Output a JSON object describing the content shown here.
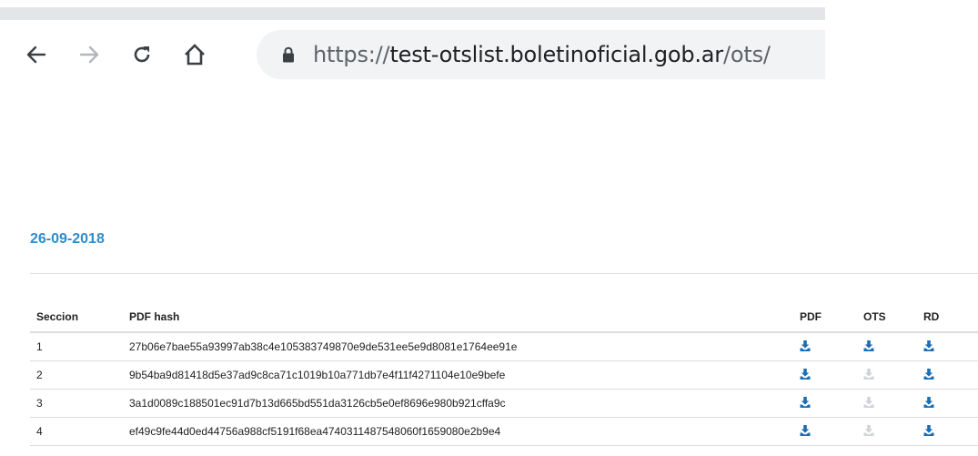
{
  "browser": {
    "url_scheme": "https://",
    "url_host": "test-otslist.boletinoficial.gob.ar",
    "url_path": "/ots/"
  },
  "page": {
    "date": "26-09-2018",
    "table": {
      "headers": [
        "Seccion",
        "PDF hash",
        "PDF",
        "OTS",
        "RD"
      ],
      "rows": [
        {
          "seccion": "1",
          "hash": "27b06e7bae55a93997ab38c4e105383749870e9de531ee5e9d8081e1764ee91e",
          "pdf": true,
          "ots": true,
          "rd": true
        },
        {
          "seccion": "2",
          "hash": "9b54ba9d81418d5e37ad9c8ca71c1019b10a771db7e4f11f4271104e10e9befe",
          "pdf": true,
          "ots": false,
          "rd": true
        },
        {
          "seccion": "3",
          "hash": "3a1d0089c188501ec91d7b13d665bd551da3126cb5e0ef8696e980b921cffa9c",
          "pdf": true,
          "ots": false,
          "rd": true
        },
        {
          "seccion": "4",
          "hash": "ef49c9fe44d0ed44756a988cf5191f68ea4740311487548060f1659080e2b9e4",
          "pdf": true,
          "ots": false,
          "rd": true
        }
      ]
    }
  },
  "colors": {
    "accent": "#2d8dcb",
    "download_active": "#1a6db3",
    "download_disabled": "#d0d4d8"
  },
  "icons": [
    "back-arrow-icon",
    "forward-arrow-icon",
    "reload-icon",
    "home-icon",
    "lock-icon",
    "download-icon"
  ]
}
